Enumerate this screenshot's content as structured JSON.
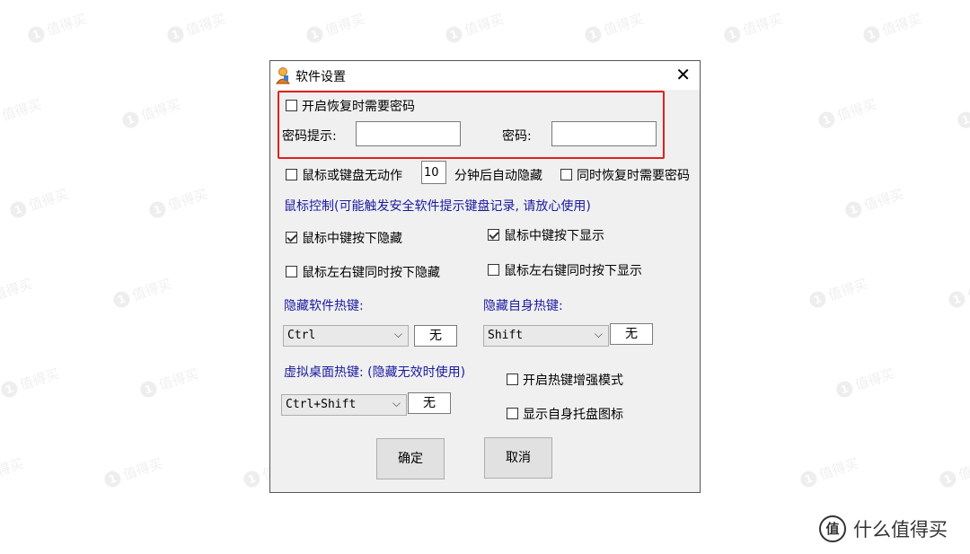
{
  "watermark": {
    "text": "值得买",
    "badge": "1"
  },
  "brand": {
    "logo": "值",
    "text": "什么值得买"
  },
  "dialog": {
    "title": "软件设置",
    "close_glyph": "✕",
    "password_section": {
      "enable_label": "开启恢复时需要密码",
      "enable_checked": false,
      "hint_label": "密码提示:",
      "hint_value": "",
      "password_label": "密码:",
      "password_value": "",
      "highlight_color": "#e02020"
    },
    "idle": {
      "label_before": "鼠标或键盘无动作",
      "minutes": "10",
      "label_after": "分钟后自动隐藏",
      "checked": false,
      "also_password_label": "同时恢复时需要密码",
      "also_password_checked": false
    },
    "mouse_control_heading": "鼠标控制(可能触发安全软件提示键盘记录, 请放心使用)",
    "mouse_options": {
      "middle_hide": {
        "label": "鼠标中键按下隐藏",
        "checked": true
      },
      "middle_show": {
        "label": "鼠标中键按下显示",
        "checked": true
      },
      "lr_hide": {
        "label": "鼠标左右键同时按下隐藏",
        "checked": false
      },
      "lr_show": {
        "label": "鼠标左右键同时按下显示",
        "checked": false
      }
    },
    "hide_hotkey": {
      "heading": "隐藏软件热键:",
      "modifier": "Ctrl",
      "key": "无"
    },
    "self_hotkey": {
      "heading": "隐藏自身热键:",
      "modifier": "Shift",
      "key": "无"
    },
    "desktop_hotkey": {
      "heading": "虚拟桌面热键: (隐藏无效时使用)",
      "modifier": "Ctrl+Shift",
      "key": "无"
    },
    "enhanced_mode": {
      "label": "开启热键增强模式",
      "checked": false
    },
    "tray_icon": {
      "label": "显示自身托盘图标",
      "checked": false
    },
    "ok_label": "确定",
    "cancel_label": "取消"
  }
}
